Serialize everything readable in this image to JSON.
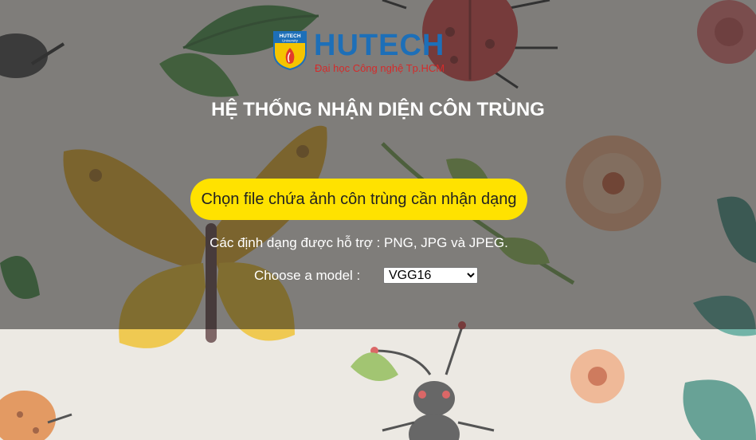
{
  "logo": {
    "shield_text": "HUTECH",
    "shield_subtext": "University",
    "wordmark": "HUTECH",
    "tagline": "Đại học Công nghệ Tp.HCM"
  },
  "title": "HỆ THỐNG NHẬN DIỆN CÔN TRÙNG",
  "upload": {
    "button_label": "Chọn file chứa ảnh côn trùng cần nhận dạng",
    "formats_note": "Các định dạng được hỗ trợ : PNG, JPG và JPEG."
  },
  "model": {
    "label": "Choose a model :",
    "selected": "VGG16",
    "options": [
      "VGG16"
    ]
  },
  "colors": {
    "button_yellow": "#ffe200",
    "brand_blue": "#1d6fb8",
    "brand_red": "#d42b2b"
  }
}
